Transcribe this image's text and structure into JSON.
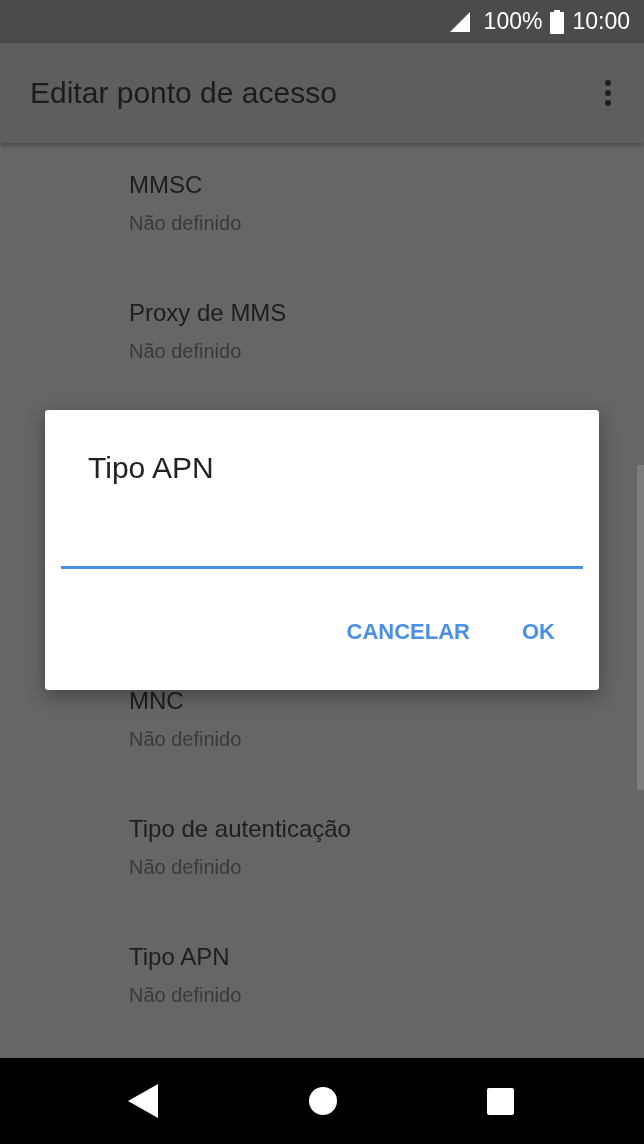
{
  "status_bar": {
    "battery": "100%",
    "time": "10:00"
  },
  "app_bar": {
    "title": "Editar ponto de acesso"
  },
  "settings": [
    {
      "title": "MMSC",
      "value": "Não definido"
    },
    {
      "title": "Proxy de MMS",
      "value": "Não definido"
    },
    {
      "title": "MNC",
      "value": "Não definido"
    },
    {
      "title": "Tipo de autenticação",
      "value": "Não definido"
    },
    {
      "title": "Tipo APN",
      "value": "Não definido"
    }
  ],
  "dialog": {
    "title": "Tipo APN",
    "buttons": [
      "CANCELAR",
      "OK"
    ]
  }
}
